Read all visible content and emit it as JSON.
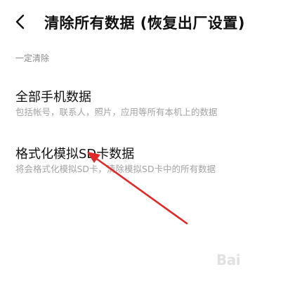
{
  "header": {
    "back_icon": "chevron-left-icon",
    "title": "清除所有数据 (恢复出厂设置)"
  },
  "section": {
    "label": "一定清除"
  },
  "items": [
    {
      "title": "全部手机数据",
      "description": "包括帐号，联系人，照片，应用等所有本机上的数据"
    },
    {
      "title": "格式化模拟SD卡数据",
      "description": "将会格式化模拟SD卡，清除模拟SD卡中的所有数据"
    }
  ],
  "annotation": {
    "arrow_color": "#e02a2a"
  },
  "watermark": {
    "text": "Bai"
  }
}
